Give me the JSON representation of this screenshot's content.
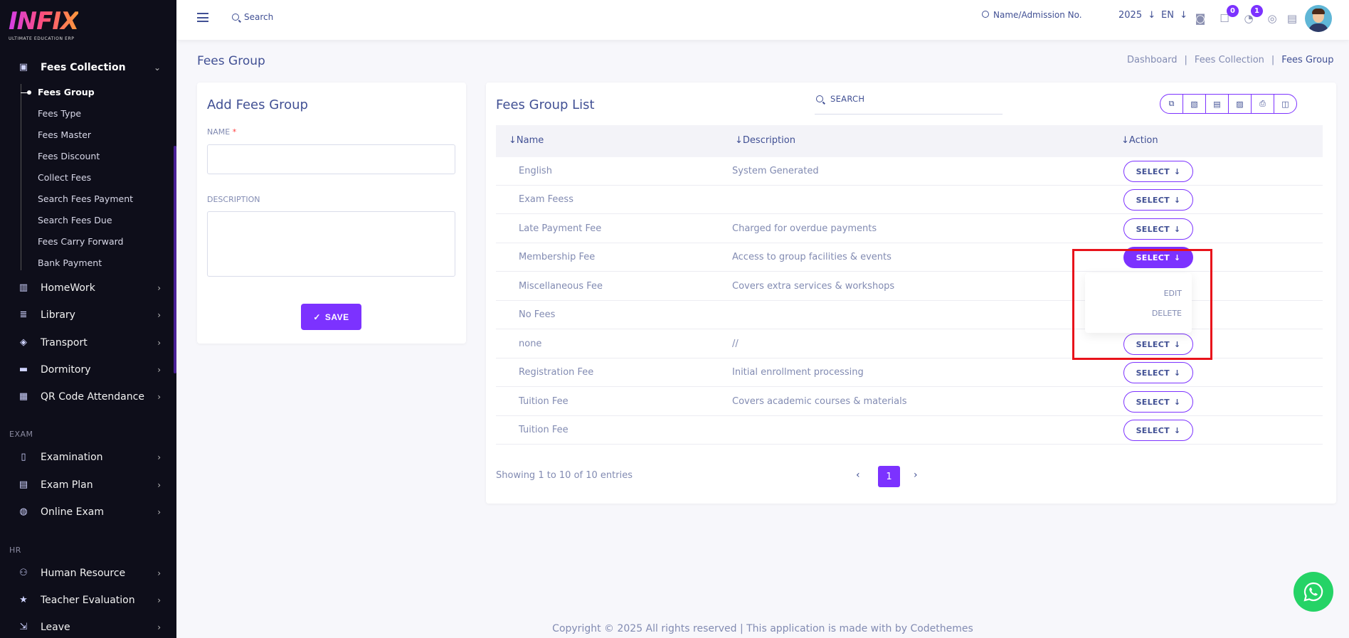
{
  "brand": {
    "name": "INFIX",
    "tagline": "ULTIMATE EDUCATION ERP"
  },
  "sidebar": {
    "open_item": {
      "label": "Fees Collection",
      "icon": "wallet-icon"
    },
    "sub_items": [
      {
        "label": "Fees Group",
        "active": true
      },
      {
        "label": "Fees Type"
      },
      {
        "label": "Fees Master"
      },
      {
        "label": "Fees Discount"
      },
      {
        "label": "Collect Fees"
      },
      {
        "label": "Search Fees Payment"
      },
      {
        "label": "Search Fees Due"
      },
      {
        "label": "Fees Carry Forward"
      },
      {
        "label": "Bank Payment"
      }
    ],
    "items": [
      {
        "label": "HomeWork",
        "icon": "book-icon"
      },
      {
        "label": "Library",
        "icon": "library-icon"
      },
      {
        "label": "Transport",
        "icon": "bus-icon"
      },
      {
        "label": "Dormitory",
        "icon": "bed-icon"
      },
      {
        "label": "QR Code Attendance",
        "icon": "qr-icon"
      }
    ],
    "exam_header": "EXAM",
    "exam_items": [
      {
        "label": "Examination",
        "icon": "map-icon"
      },
      {
        "label": "Exam Plan",
        "icon": "clipboard-icon"
      },
      {
        "label": "Online Exam",
        "icon": "globe-icon"
      }
    ],
    "hr_header": "HR",
    "hr_items": [
      {
        "label": "Human Resource",
        "icon": "users-icon"
      },
      {
        "label": "Teacher Evaluation",
        "icon": "star-icon"
      },
      {
        "label": "Leave",
        "icon": "leave-icon"
      }
    ]
  },
  "topbar": {
    "search_label": "Search",
    "admission_search": "Name/Admission No.",
    "year": "2025",
    "language": "EN",
    "messages_count": "0",
    "notifications_count": "1"
  },
  "page": {
    "title": "Fees Group",
    "breadcrumb": [
      "Dashboard",
      "Fees Collection",
      "Fees Group"
    ]
  },
  "form": {
    "title": "Add Fees Group",
    "name_label": "NAME",
    "required_mark": "*",
    "description_label": "DESCRIPTION",
    "name_value": "",
    "description_value": "",
    "save_label": "SAVE"
  },
  "list": {
    "title": "Fees Group List",
    "search_placeholder": "SEARCH",
    "columns": [
      "Name",
      "Description",
      "Action"
    ],
    "select_label": "SELECT",
    "rows": [
      {
        "name": "English",
        "description": "System Generated"
      },
      {
        "name": "Exam Feess",
        "description": ""
      },
      {
        "name": "Late Payment Fee",
        "description": "Charged for overdue payments"
      },
      {
        "name": "Membership Fee",
        "description": "Access to group facilities & events"
      },
      {
        "name": "Miscellaneous Fee",
        "description": "Covers extra services & workshops"
      },
      {
        "name": "No Fees",
        "description": ""
      },
      {
        "name": "none",
        "description": "//"
      },
      {
        "name": "Registration Fee",
        "description": "Initial enrollment processing"
      },
      {
        "name": "Tuition Fee",
        "description": "Covers academic courses & materials"
      },
      {
        "name": "Tuition Fee",
        "description": ""
      }
    ],
    "dropdown": {
      "edit": "EDIT",
      "delete": "DELETE"
    },
    "showing": "Showing 1 to 10 of 10 entries",
    "current_page": "1"
  },
  "footer": "Copyright © 2025 All rights reserved | This application is made with by Codethemes",
  "colors": {
    "accent": "#7c32ff",
    "text": "#415094",
    "muted": "#828bb2",
    "highlight": "#e8131b",
    "whatsapp": "#25d366"
  }
}
